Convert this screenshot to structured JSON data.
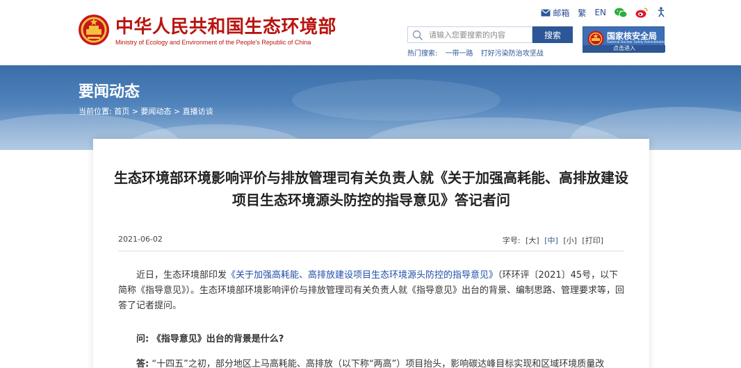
{
  "header": {
    "site_title": "中华人民共和国生态环境部",
    "site_subtitle": "Ministry of Ecology and Environment of the People's Republic of China",
    "top_links": {
      "mail": "邮箱",
      "traditional": "繁",
      "english": "EN"
    },
    "search": {
      "placeholder": "请输入您要搜索的内容",
      "button": "搜索"
    },
    "hot_search": {
      "label": "热门搜索:",
      "items": [
        "一带一路",
        "打好污染防治攻坚战"
      ]
    },
    "nnsa": {
      "title": "国家核安全局",
      "subtitle": "National Nuclear Safety Administration",
      "enter": "点击进入"
    }
  },
  "banner": {
    "title": "要闻动态",
    "breadcrumb": "当前位置: 首页 > 要闻动态 > 直播访谈"
  },
  "article": {
    "title": "生态环境部环境影响评价与排放管理司有关负责人就《关于加强高耗能、高排放建设项目生态环境源头防控的指导意见》答记者问",
    "date": "2021-06-02",
    "font_size_label": "字号:",
    "size_large": "[大]",
    "size_medium": "[中]",
    "size_small": "[小]",
    "print": "[打印]",
    "p1_before": "近日，生态环境部印发",
    "p1_link": "《关于加强高耗能、高排放建设项目生态环境源头防控的指导意见》",
    "p1_after": "（环环评〔2021〕45号，以下简称《指导意见》）。生态环境部环境影响评价与排放管理司有关负责人就《指导意见》出台的背景、编制思路、管理要求等，回答了记者提问。",
    "question": "问: 《指导意见》出台的背景是什么?",
    "answer_label": "答:",
    "answer_text": "“十四五”之初，部分地区上马高耗能、高排放（以下称“两高”）项目抬头，影响碳达峰目标实现和区域环境质量改"
  },
  "colors": {
    "brand_red": "#b8150f",
    "brand_blue": "#2c5696",
    "link_blue": "#1f4fa8"
  }
}
